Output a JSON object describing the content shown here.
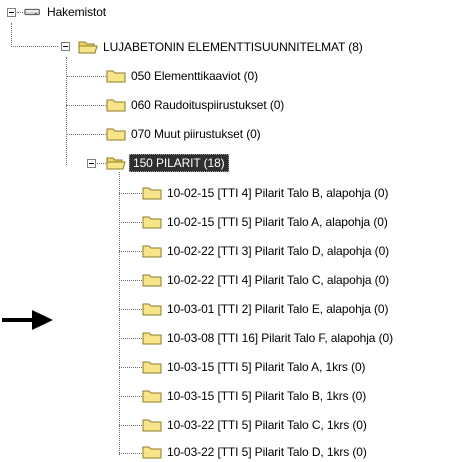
{
  "tree": {
    "root": {
      "label": "Hakemistot",
      "icon": "drive-icon",
      "expanded": true
    },
    "folder": {
      "label": "LUJABETONIN ELEMENTTISUUNNITELMAT (8)",
      "icon": "open-folder-icon",
      "expanded": true
    },
    "children": [
      {
        "label": "050 Elementtikaaviot (0)",
        "icon": "folder-icon"
      },
      {
        "label": "060 Raudoituspiirustukset (0)",
        "icon": "folder-icon"
      },
      {
        "label": "070 Muut piirustukset (0)",
        "icon": "folder-icon"
      }
    ],
    "selected": {
      "label": "150 PILARIT (18)",
      "icon": "open-folder-icon",
      "expanded": true
    },
    "pilarit": [
      {
        "label": "10-02-15 [TTI 4] Pilarit Talo B, alapohja (0)"
      },
      {
        "label": "10-02-15 [TTI 5] Pilarit Talo A, alapohja (0)"
      },
      {
        "label": "10-02-22 [TTI 3] Pilarit Talo D, alapohja (0)"
      },
      {
        "label": "10-02-22 [TTI 4] Pilarit Talo C, alapohja (0)"
      },
      {
        "label": "10-03-01 [TTI 2] Pilarit Talo E, alapohja (0)"
      },
      {
        "label": "10-03-08 [TTI 16] Pilarit Talo F, alapohja (0)"
      },
      {
        "label": "10-03-15 [TTI 5] Pilarit Talo A, 1krs (0)"
      },
      {
        "label": "10-03-15 [TTI 5] Pilarit Talo B, 1krs (0)"
      },
      {
        "label": "10-03-22 [TTI 5] Pilarit Talo C, 1krs (0)"
      },
      {
        "label": "10-03-22 [TTI 5] Pilarit Talo D, 1krs (0)"
      }
    ]
  },
  "annotation": {
    "icon": "arrow-right-icon"
  },
  "colors": {
    "folder_fill": "#f8e58a",
    "folder_stroke": "#8c7a2a",
    "selection_bg": "#2f2f2f",
    "tree_lines": "#707070"
  }
}
